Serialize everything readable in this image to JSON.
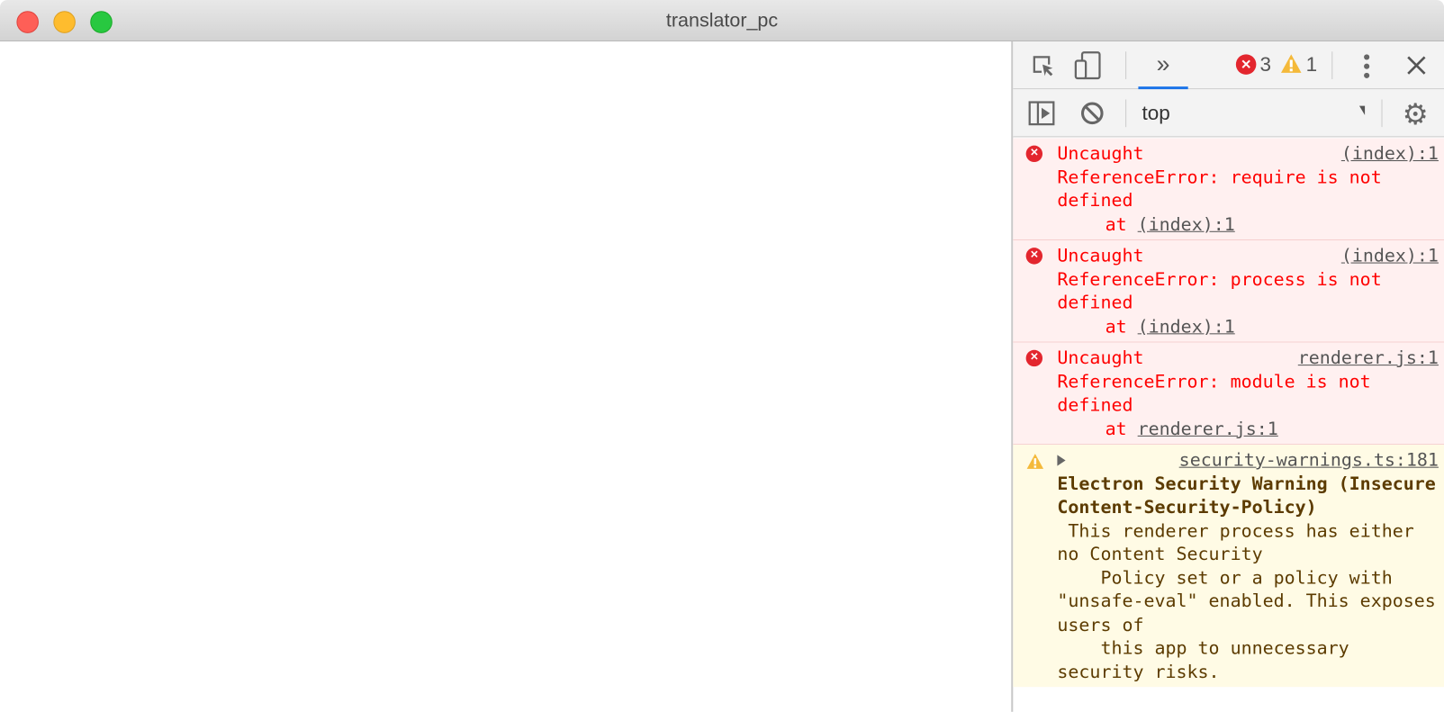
{
  "window": {
    "title": "translator_pc"
  },
  "devtools": {
    "toolbar": {
      "more_tabs": "»",
      "error_count": "3",
      "warning_count": "1"
    },
    "console_toolbar": {
      "context": "top"
    },
    "messages": [
      {
        "level": "error",
        "head": "Uncaught",
        "source": "(index):1",
        "body": "ReferenceError: require is not defined",
        "at_label": "at",
        "at_link": "(index):1"
      },
      {
        "level": "error",
        "head": "Uncaught",
        "source": "(index):1",
        "body": "ReferenceError: process is not defined",
        "at_label": "at",
        "at_link": "(index):1"
      },
      {
        "level": "error",
        "head": "Uncaught",
        "source": "renderer.js:1",
        "body": "ReferenceError: module is not defined",
        "at_label": "at",
        "at_link": "renderer.js:1"
      }
    ],
    "warning": {
      "source": "security-warnings.ts:181",
      "title": "Electron Security Warning (Insecure Content-Security-Policy)",
      "body": " This renderer process has either no Content Security\n    Policy set or a policy with \"unsafe-eval\" enabled. This exposes users of\n    this app to unnecessary security risks."
    }
  },
  "colors": {
    "error": "#ff0000",
    "warning_text": "#5c3b00",
    "accent": "#1a73e8"
  }
}
